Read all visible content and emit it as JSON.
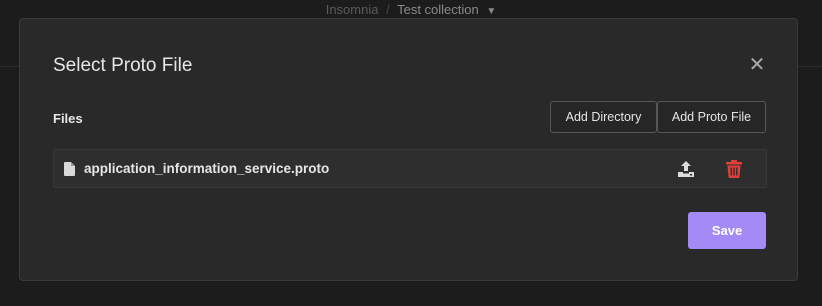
{
  "topbar": {
    "workspace": "Insomnia",
    "separator": "/",
    "collection": "Test collection",
    "caret": "▼"
  },
  "modal": {
    "title": "Select Proto File",
    "close_glyph": "✕",
    "files_label": "Files",
    "add_directory_label": "Add Directory",
    "add_proto_file_label": "Add Proto File",
    "files": [
      {
        "name": "application_information_service.proto"
      }
    ],
    "save_label": "Save"
  },
  "colors": {
    "accent": "#a48af5",
    "delete": "#e0403a",
    "background": "#292929"
  },
  "icons": {
    "file": "file-icon",
    "upload": "upload-icon",
    "delete": "trash-icon",
    "close": "close-icon"
  }
}
